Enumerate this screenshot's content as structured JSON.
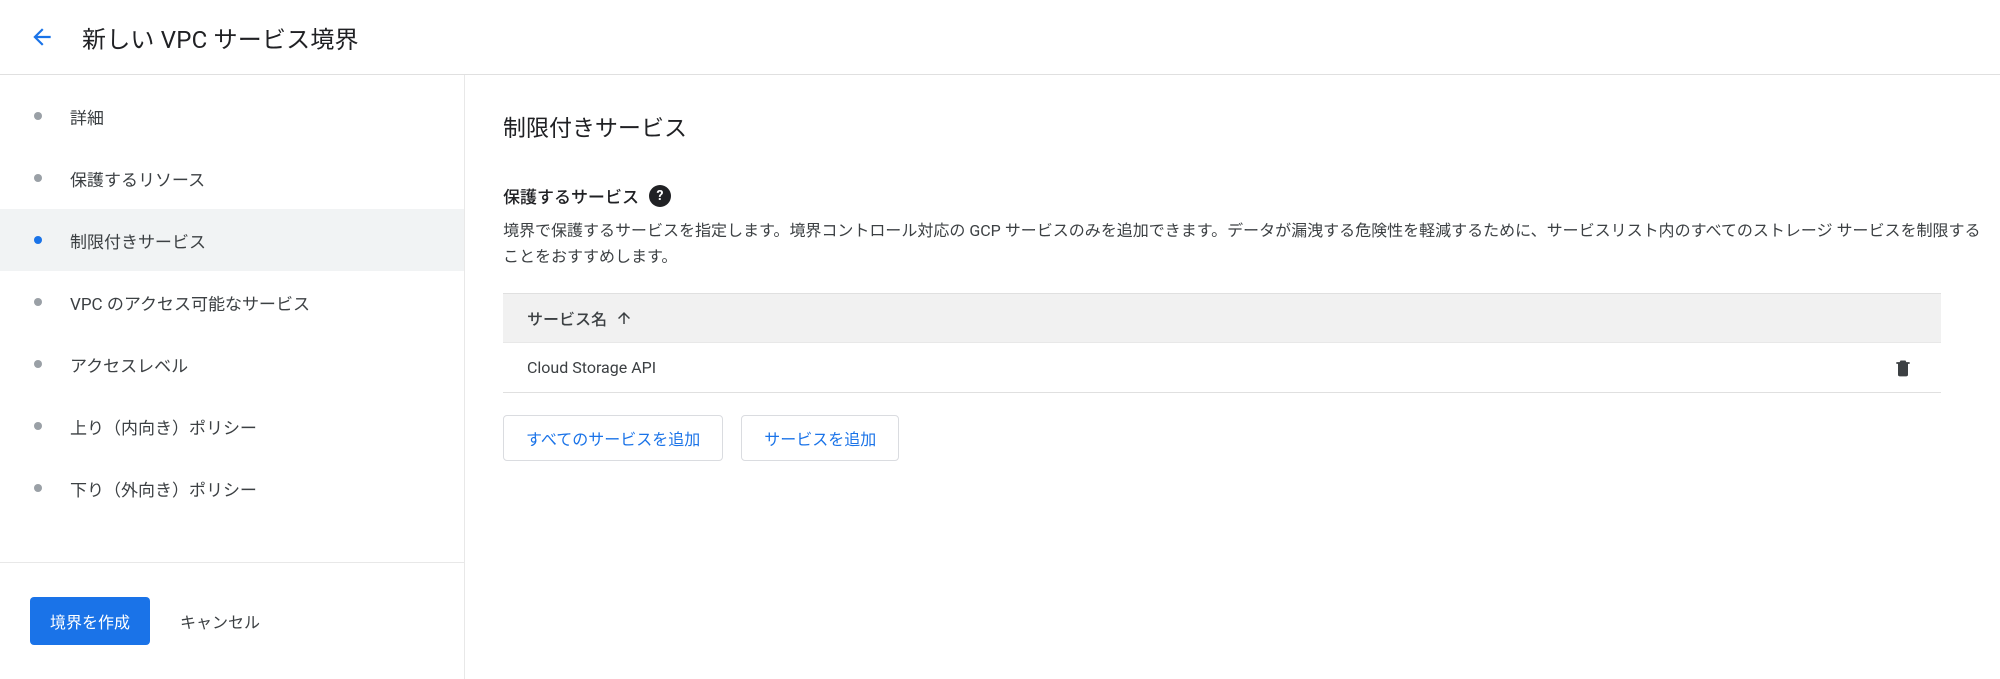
{
  "header": {
    "title": "新しい VPC サービス境界"
  },
  "nav": {
    "items": [
      {
        "label": "詳細",
        "active": false
      },
      {
        "label": "保護するリソース",
        "active": false
      },
      {
        "label": "制限付きサービス",
        "active": true
      },
      {
        "label": "VPC のアクセス可能なサービス",
        "active": false
      },
      {
        "label": "アクセスレベル",
        "active": false
      },
      {
        "label": "上り（内向き）ポリシー",
        "active": false
      },
      {
        "label": "下り（外向き）ポリシー",
        "active": false
      }
    ],
    "primary_action": "境界を作成",
    "cancel": "キャンセル"
  },
  "main": {
    "section_title": "制限付きサービス",
    "field_label": "保護するサービス",
    "description": "境界で保護するサービスを指定します。境界コントロール対応の GCP サービスのみを追加できます。データが漏洩する危険性を軽減するために、サービスリスト内のすべてのストレージ サービスを制限することをおすすめします。",
    "table": {
      "header": "サービス名",
      "rows": [
        {
          "name": "Cloud Storage API"
        }
      ]
    },
    "add_all": "すべてのサービスを追加",
    "add": "サービスを追加"
  }
}
